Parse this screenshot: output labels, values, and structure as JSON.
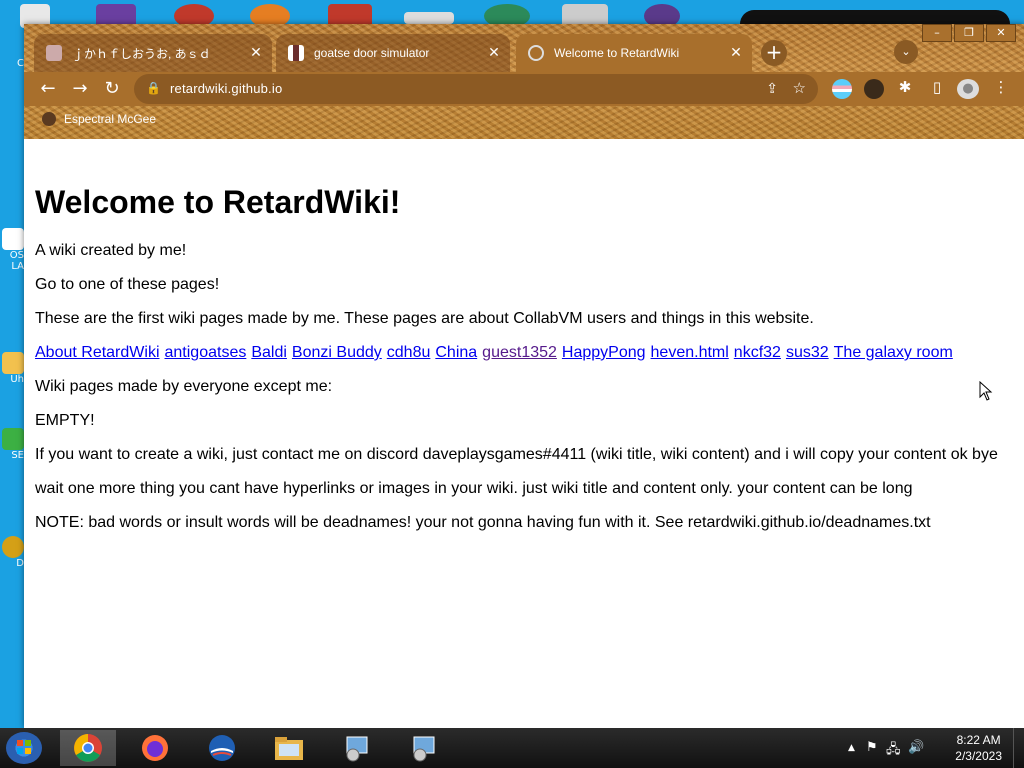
{
  "desktop": {
    "side_labels": [
      "C",
      "OS",
      "LA",
      "Uh",
      "SE",
      "D"
    ]
  },
  "browser": {
    "tabs": [
      {
        "title": "ｊかｈｆしおうお, あｓｄ",
        "active": false
      },
      {
        "title": "goatse door simulator",
        "active": false
      },
      {
        "title": "Welcome to RetardWiki",
        "active": true
      }
    ],
    "new_tab_label": "+",
    "url": "retardwiki.github.io",
    "bookmark": "Espectral McGee"
  },
  "page": {
    "heading": "Welcome to RetardWiki!",
    "intro": "A wiki created by me!",
    "goto": "Go to one of these pages!",
    "first_pages": "These are the first wiki pages made by me. These pages are about CollabVM users and things in this website.",
    "links": [
      {
        "label": "About RetardWiki",
        "visited": false
      },
      {
        "label": "antigoatses",
        "visited": false
      },
      {
        "label": "Baldi",
        "visited": false
      },
      {
        "label": "Bonzi Buddy",
        "visited": false
      },
      {
        "label": "cdh8u",
        "visited": false
      },
      {
        "label": "China",
        "visited": false
      },
      {
        "label": "guest1352",
        "visited": true
      },
      {
        "label": "HappyPong",
        "visited": false
      },
      {
        "label": "heven.html",
        "visited": false
      },
      {
        "label": "nkcf32",
        "visited": false
      },
      {
        "label": "sus32",
        "visited": false
      },
      {
        "label": "The galaxy room",
        "visited": false
      }
    ],
    "everyone": "Wiki pages made by everyone except me:",
    "empty": "EMPTY!",
    "create": "If you want to create a wiki, just contact me on discord daveplaysgames#4411 (wiki title, wiki content) and i will copy your content ok bye",
    "wait": "wait one more thing you cant have hyperlinks or images in your wiki. just wiki title and content only. your content can be long",
    "note": "NOTE: bad words or insult words will be deadnames! your not gonna having fun with it. See retardwiki.github.io/deadnames.txt"
  },
  "taskbar": {
    "time": "8:22 AM",
    "date": "2/3/2023"
  },
  "colors": {
    "desktop": "#1ba1e2",
    "theme_brown": "#a86f2c",
    "link": "#0000ee",
    "visited": "#551a8b"
  }
}
